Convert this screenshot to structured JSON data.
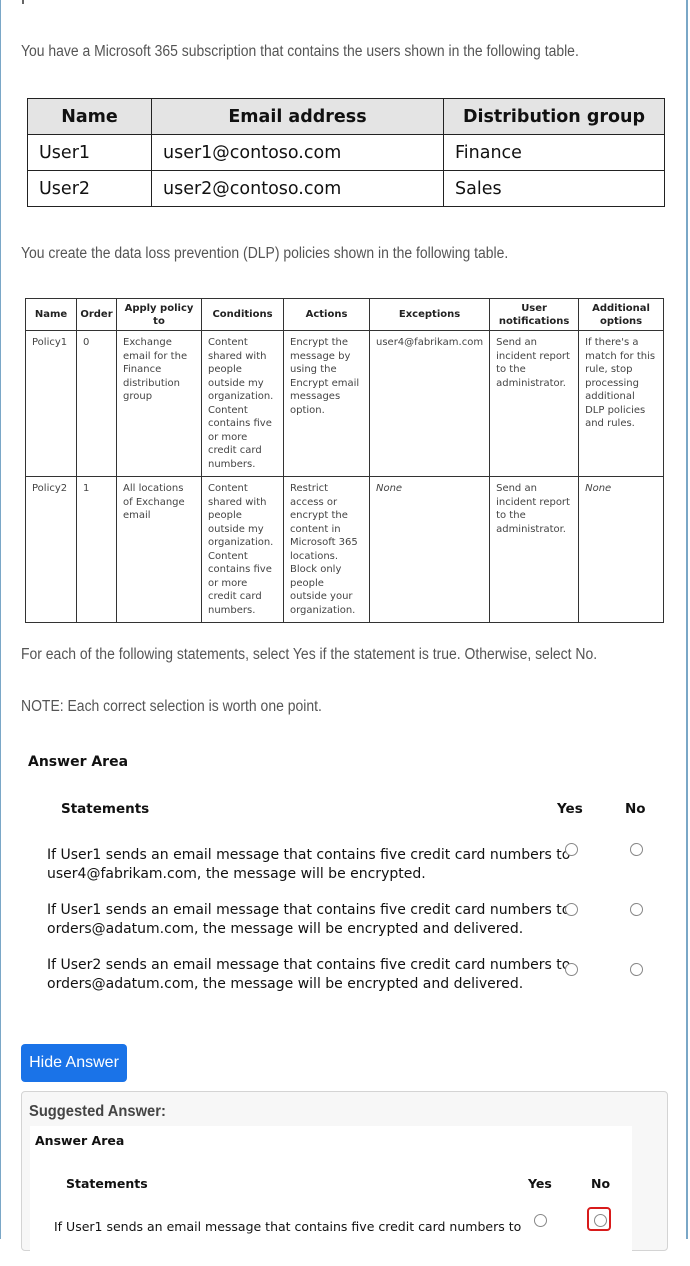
{
  "intro": "You have a Microsoft 365 subscription that contains the users shown in the following table.",
  "users_table": {
    "headers": [
      "Name",
      "Email address",
      "Distribution group"
    ],
    "rows": [
      [
        "User1",
        "user1@contoso.com",
        "Finance"
      ],
      [
        "User2",
        "user2@contoso.com",
        "Sales"
      ]
    ]
  },
  "dlp_intro": "You create the data loss prevention (DLP) policies shown in the following table.",
  "dlp_table": {
    "headers": [
      "Name",
      "Order",
      "Apply policy to",
      "Conditions",
      "Actions",
      "Exceptions",
      "User notifications",
      "Additional options"
    ],
    "rows": [
      [
        "Policy1",
        "0",
        "Exchange email for the Finance distribution group",
        "Content shared with people outside my organization. Content contains five or more credit card numbers.",
        "Encrypt the message by using the Encrypt email messages option.",
        "user4@fabrikam.com",
        "Send an incident report to the administrator.",
        "If there's a match for this rule, stop processing additional DLP policies and rules."
      ],
      [
        "Policy2",
        "1",
        "All locations of Exchange email",
        "Content shared with people outside my organization. Content contains five or more credit card numbers.",
        "Restrict access or encrypt the content in Microsoft 365 locations. Block only people outside your organization.",
        "None",
        "Send an incident report to the administrator.",
        "None"
      ]
    ]
  },
  "instruction": "For each of the following statements, select Yes if the statement is true. Otherwise, select No.",
  "note": "NOTE: Each correct selection is worth one point.",
  "answer_area": {
    "title": "Answer Area",
    "statements_header": "Statements",
    "yes_label": "Yes",
    "no_label": "No",
    "statements": [
      {
        "line1": "If User1 sends an email message that contains five credit card numbers to",
        "line2": "user4@fabrikam.com, the message will be encrypted."
      },
      {
        "line1": "If User1 sends an email message that contains five credit card numbers to",
        "line2": "orders@adatum.com, the message will be encrypted and delivered."
      },
      {
        "line1": "If User2 sends an email message that contains five credit card numbers to",
        "line2": "orders@adatum.com, the message will be encrypted and delivered."
      }
    ]
  },
  "hide_answer_button": "Hide Answer",
  "suggested": {
    "title": "Suggested Answer:",
    "answer_area_title": "Answer Area",
    "statements_header": "Statements",
    "yes_label": "Yes",
    "no_label": "No",
    "first_statement": "If User1 sends an email message that contains five credit card numbers to",
    "first_selected": "No"
  },
  "colors": {
    "button": "#1a73e8",
    "selection_box": "#d81b1b"
  }
}
